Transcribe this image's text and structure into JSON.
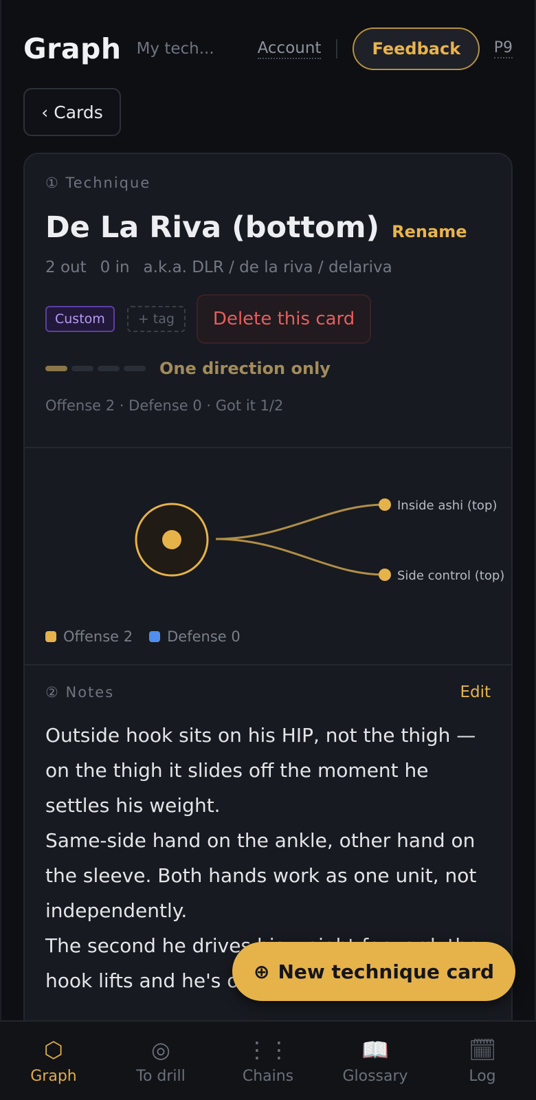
{
  "header": {
    "brand": "Graph",
    "subtitle": "My tech...",
    "account": "Account",
    "feedback": "Feedback",
    "profile": "P9"
  },
  "back_button": {
    "label": "Cards"
  },
  "card": {
    "section1_label": "① Technique",
    "title": "De La Riva (bottom)",
    "rename": "Rename",
    "meta": {
      "out": "2 out",
      "in": "0 in",
      "aka": "a.k.a. DLR / de la riva / delariva"
    },
    "tags": {
      "custom": "Custom",
      "add": "+ tag"
    },
    "delete": "Delete this card",
    "progress": {
      "level": 1,
      "of": 4,
      "label": "One direction only"
    },
    "stats": "Offense 2 · Defense 0 · Got it 1/2",
    "graph": {
      "nodes": [
        "Inside ashi (top)",
        "Side control (top)"
      ],
      "colors": {
        "offense": "#e6b24a",
        "defense": "#4f8ff0",
        "edge": "#b18e48"
      }
    },
    "legend": {
      "offense": "Offense 2",
      "defense": "Defense 0"
    },
    "section2_label": "② Notes",
    "edit": "Edit",
    "notes": [
      "Outside hook sits on his HIP, not the thigh — on the thigh it slides off the moment he settles his weight.",
      "Same-side hand on the ankle, other hand on the sleeve. Both hands work as one unit, not independently.",
      "The second he drives his weight forward, the hook lifts and he's off balance."
    ]
  },
  "fab": {
    "icon": "⊕",
    "label": "New technique card"
  },
  "nav": [
    {
      "icon": "⬡",
      "label": "Graph"
    },
    {
      "icon": "◎",
      "label": "To drill"
    },
    {
      "icon": "⋮⋮",
      "label": "Chains"
    },
    {
      "icon": "📖",
      "label": "Glossary"
    },
    {
      "icon": "🗓",
      "label": "Log"
    }
  ]
}
